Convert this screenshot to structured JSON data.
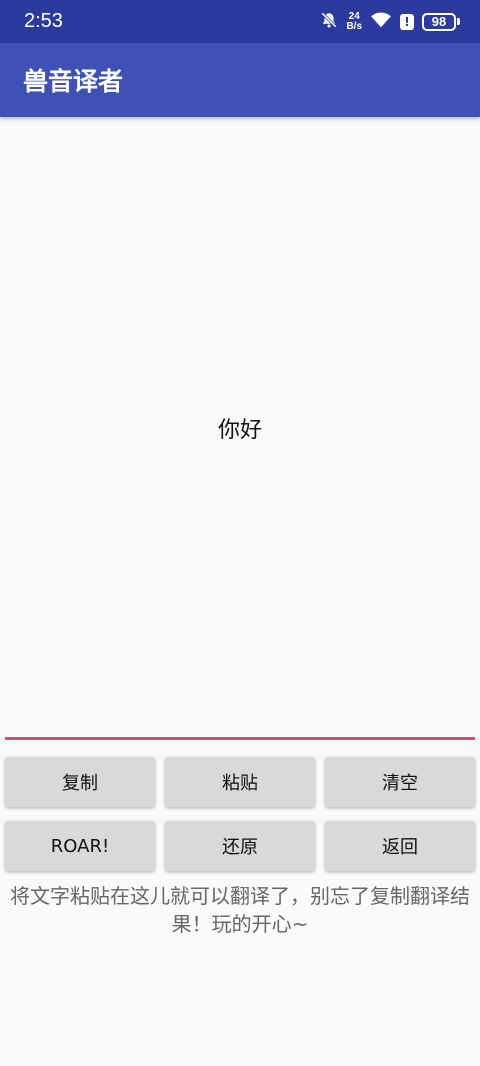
{
  "status_bar": {
    "time": "2:53",
    "net_speed_value": "24",
    "net_speed_unit": "B/s",
    "alert_glyph": "!",
    "battery": "98"
  },
  "app_bar": {
    "title": "兽音译者"
  },
  "editor": {
    "text": "你好"
  },
  "buttons": {
    "copy": "复制",
    "paste": "粘贴",
    "clear": "清空",
    "roar": "ROAR!",
    "restore": "还原",
    "back": "返回"
  },
  "hint": "将文字粘贴在这儿就可以翻译了，别忘了复制翻译结果！玩的开心~",
  "colors": {
    "status_bar": "#2c3a9e",
    "app_bar": "#3f51b5",
    "underline": "#d4487a",
    "button_bg": "#d9d9d9"
  }
}
